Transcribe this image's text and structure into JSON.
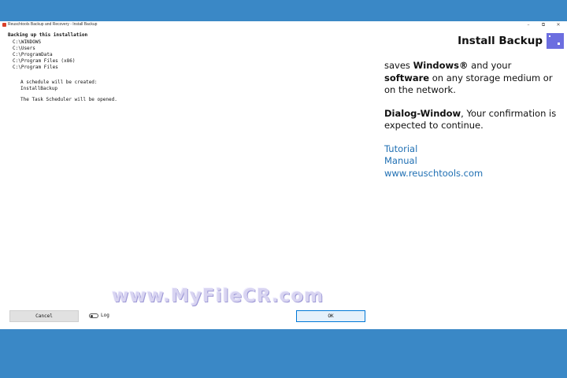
{
  "window": {
    "title": "Reuschtools Backup and Recovery - Install Backup",
    "minimize_glyph": "–",
    "restore_glyph": "⧉",
    "close_glyph": "✕"
  },
  "left": {
    "heading": "Backing up this installation",
    "paths": [
      "C:\\WINDOWS",
      "C:\\Users",
      "C:\\ProgramData",
      "C:\\Program Files (x86)",
      "C:\\Program Files"
    ],
    "schedule_line1": "A schedule will be created:",
    "schedule_line2": "InstallBackup",
    "scheduler_note": "The Task Scheduler will be opened."
  },
  "right": {
    "app_title": "Install Backup",
    "desc1_a": "saves ",
    "desc1_b": "Windows®",
    "desc1_c": " and your ",
    "desc1_d": "software",
    "desc1_e": " on any storage medium or on the network.",
    "desc2_a": "Dialog-Window",
    "desc2_b": ", Your confirmation is expected to continue.",
    "links": [
      "Tutorial",
      "Manual",
      "www.reuschtools.com"
    ],
    "link_color": "#1f6fb3",
    "logo_color": "#6c6ee0"
  },
  "footer": {
    "cancel_label": "Cancel",
    "log_label": "Log",
    "log_toggle_on": false,
    "ok_label": "OK"
  },
  "watermark": "www.MyFileCR.com",
  "colors": {
    "background": "#3a88c6",
    "ok_border": "#0078d7"
  }
}
